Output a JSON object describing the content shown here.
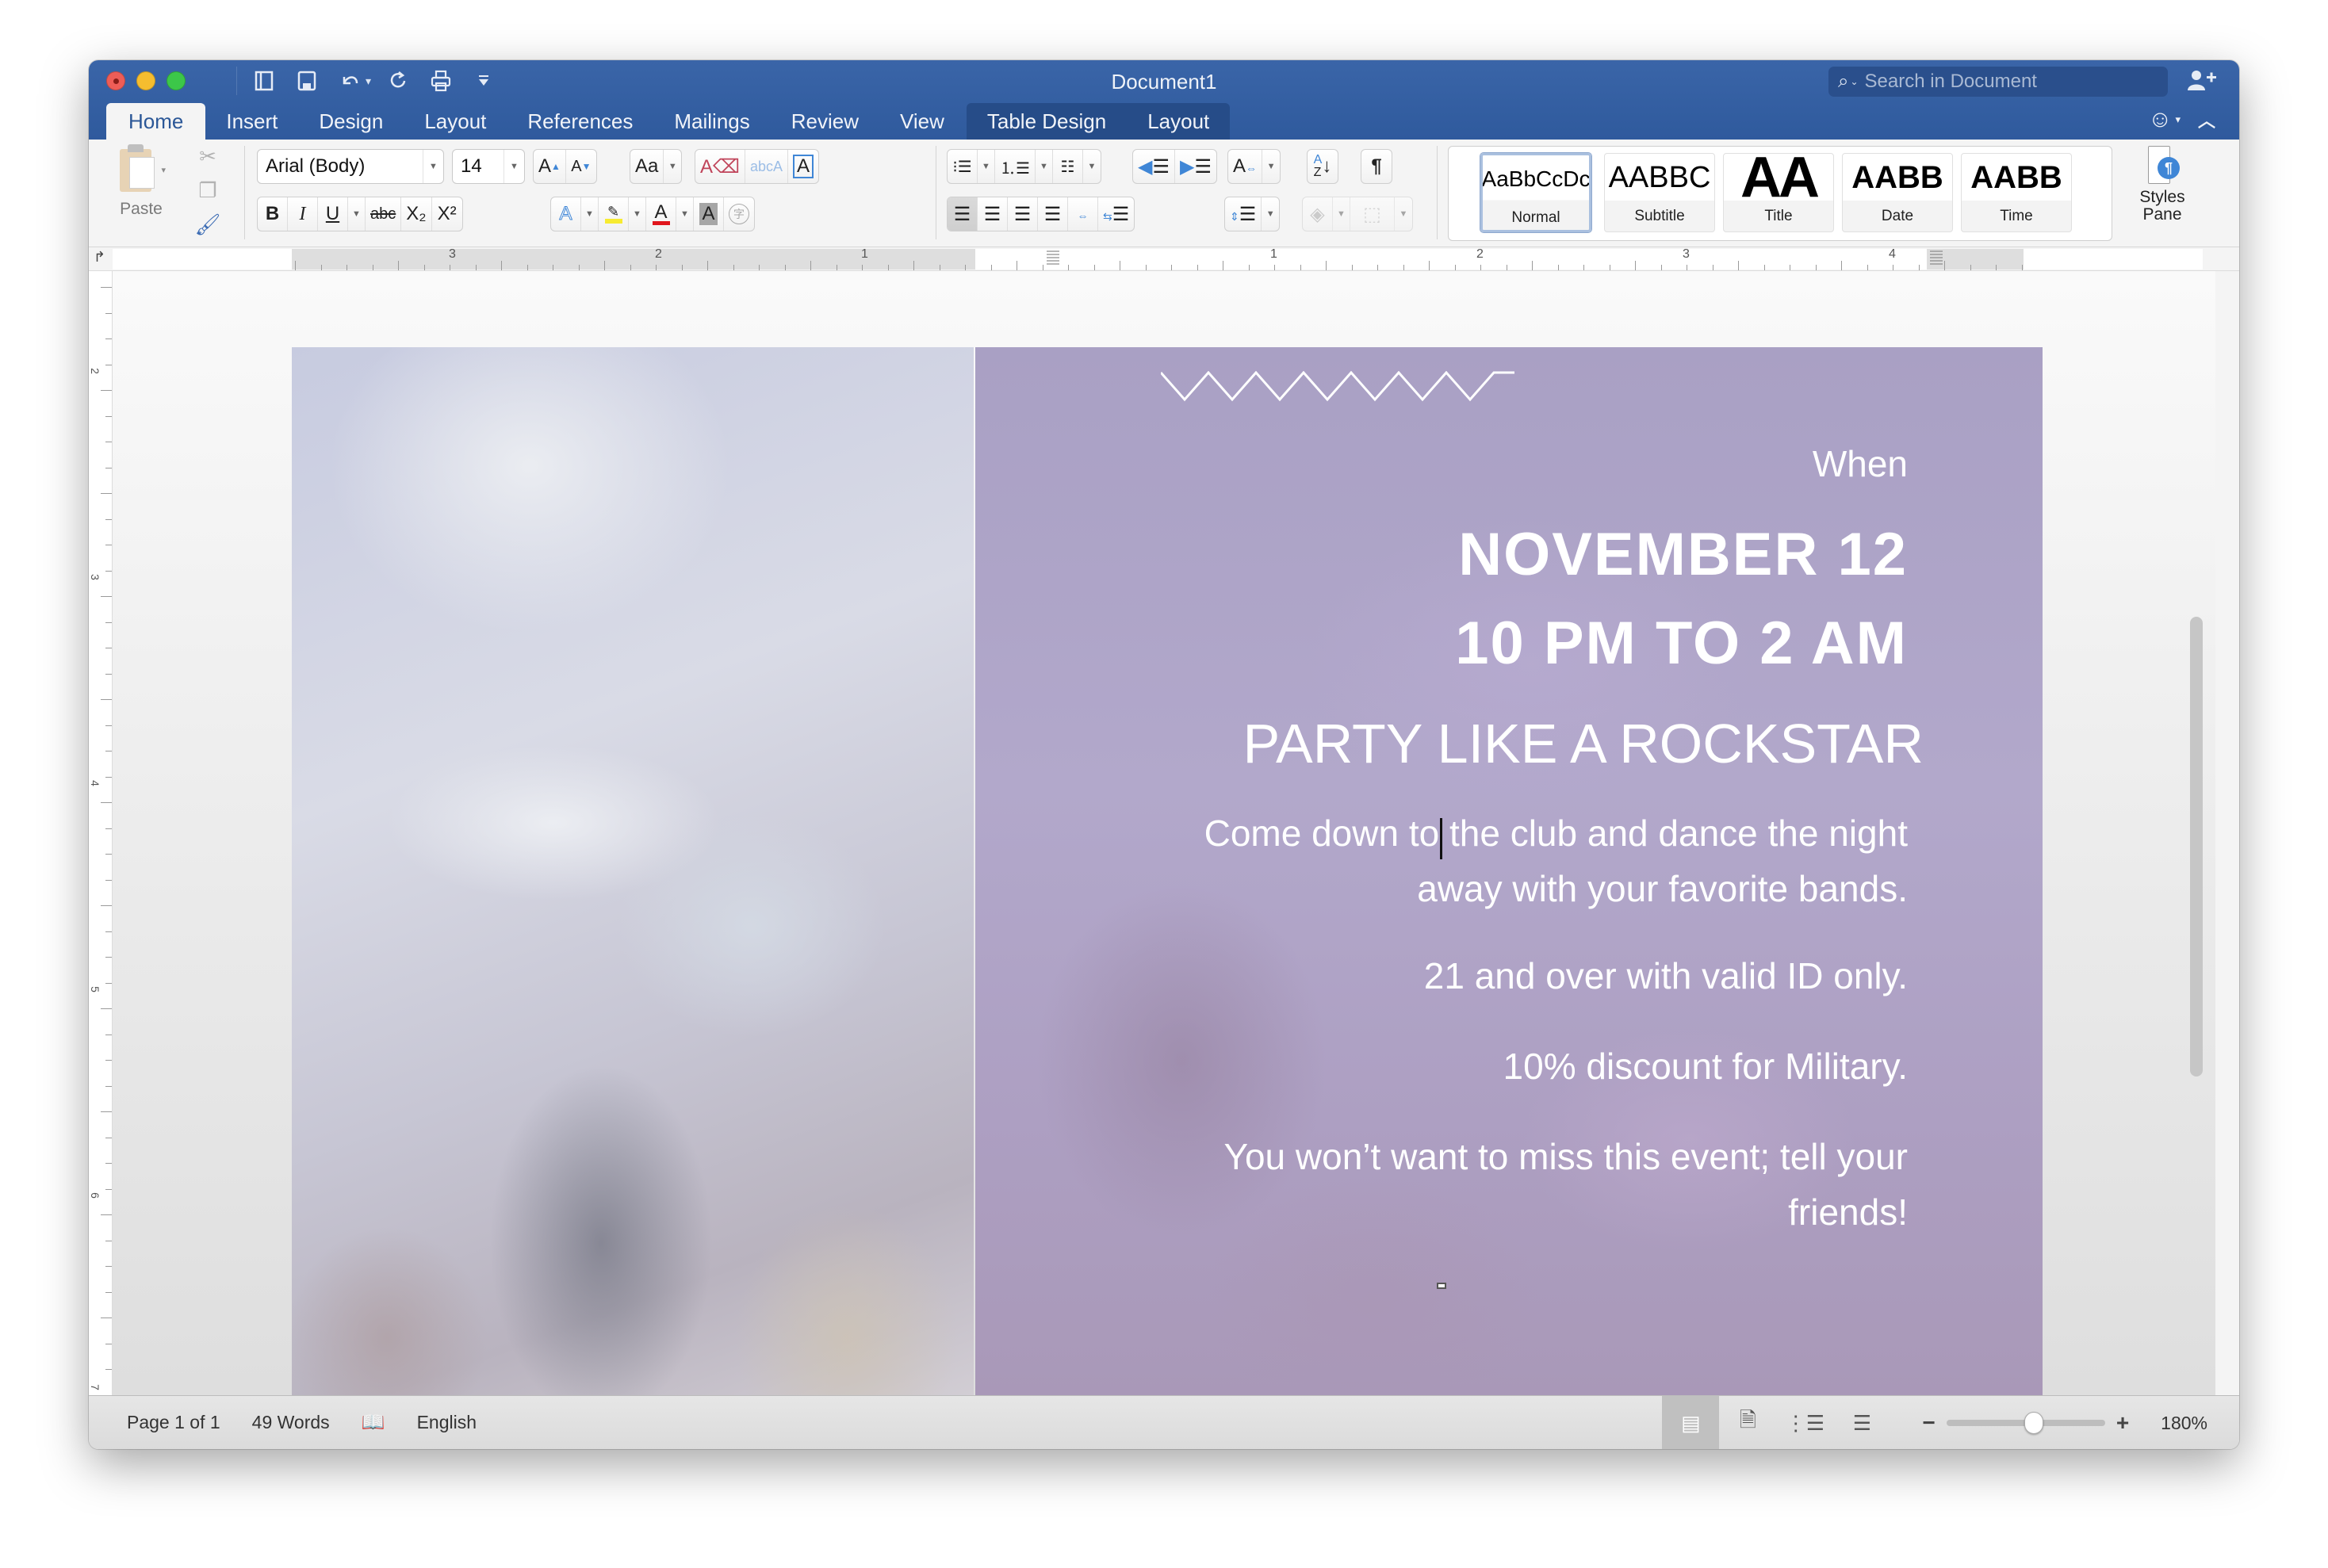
{
  "window": {
    "title": "Document1",
    "search_placeholder": "Search in Document"
  },
  "quick_access": {
    "items": [
      "sidebar-toggle",
      "save",
      "undo",
      "redo",
      "print",
      "customize"
    ]
  },
  "tabs": [
    {
      "label": "Home",
      "active": true
    },
    {
      "label": "Insert"
    },
    {
      "label": "Design"
    },
    {
      "label": "Layout"
    },
    {
      "label": "References"
    },
    {
      "label": "Mailings"
    },
    {
      "label": "Review"
    },
    {
      "label": "View"
    }
  ],
  "context_tabs": [
    {
      "label": "Table Design"
    },
    {
      "label": "Layout"
    }
  ],
  "ribbon": {
    "paste_label": "Paste",
    "font_name": "Arial (Body)",
    "font_size": "14",
    "bold": "B",
    "italic": "I",
    "underline": "U",
    "strikethrough": "abc",
    "subscript": "X₂",
    "superscript": "X²",
    "styles": [
      {
        "preview": "AaBbCcDc",
        "label": "Normal",
        "selected": true
      },
      {
        "preview": "AABBC",
        "label": "Subtitle"
      },
      {
        "preview": "AA",
        "label": "Title"
      },
      {
        "preview": "AABB",
        "label": "Date"
      },
      {
        "preview": "AABB",
        "label": "Time"
      }
    ],
    "styles_pane_label_1": "Styles",
    "styles_pane_label_2": "Pane"
  },
  "ruler": {
    "horizontal_left_numbers": [
      "3",
      "2",
      "1"
    ],
    "horizontal_right_numbers": [
      "1",
      "2",
      "3",
      "4"
    ],
    "vertical_numbers": [
      "2",
      "3",
      "4",
      "5",
      "6",
      "7"
    ]
  },
  "document": {
    "when": "When",
    "date": "NOVEMBER 12",
    "time": "10 PM TO 2 AM",
    "headline": "PARTY LIKE A ROCKSTAR",
    "body_1_line_1": "Come down to the club and dance the night",
    "body_1_line_2": "away with your favorite bands.",
    "body_2": "21 and over with valid ID only.",
    "body_3": "10% discount for Military.",
    "body_4_line_1": "You won’t want to miss this event; tell your",
    "body_4_line_2": "friends!"
  },
  "status": {
    "page": "Page 1 of 1",
    "words": "49 Words",
    "language": "English",
    "zoom": "180%",
    "zoom_slider_fraction": 0.55
  },
  "colors": {
    "titlebar": "#2f5a9d",
    "accent_blue": "#3f86d6",
    "font_color_red": "#e0161d",
    "highlight_yellow": "#f7eb31"
  }
}
